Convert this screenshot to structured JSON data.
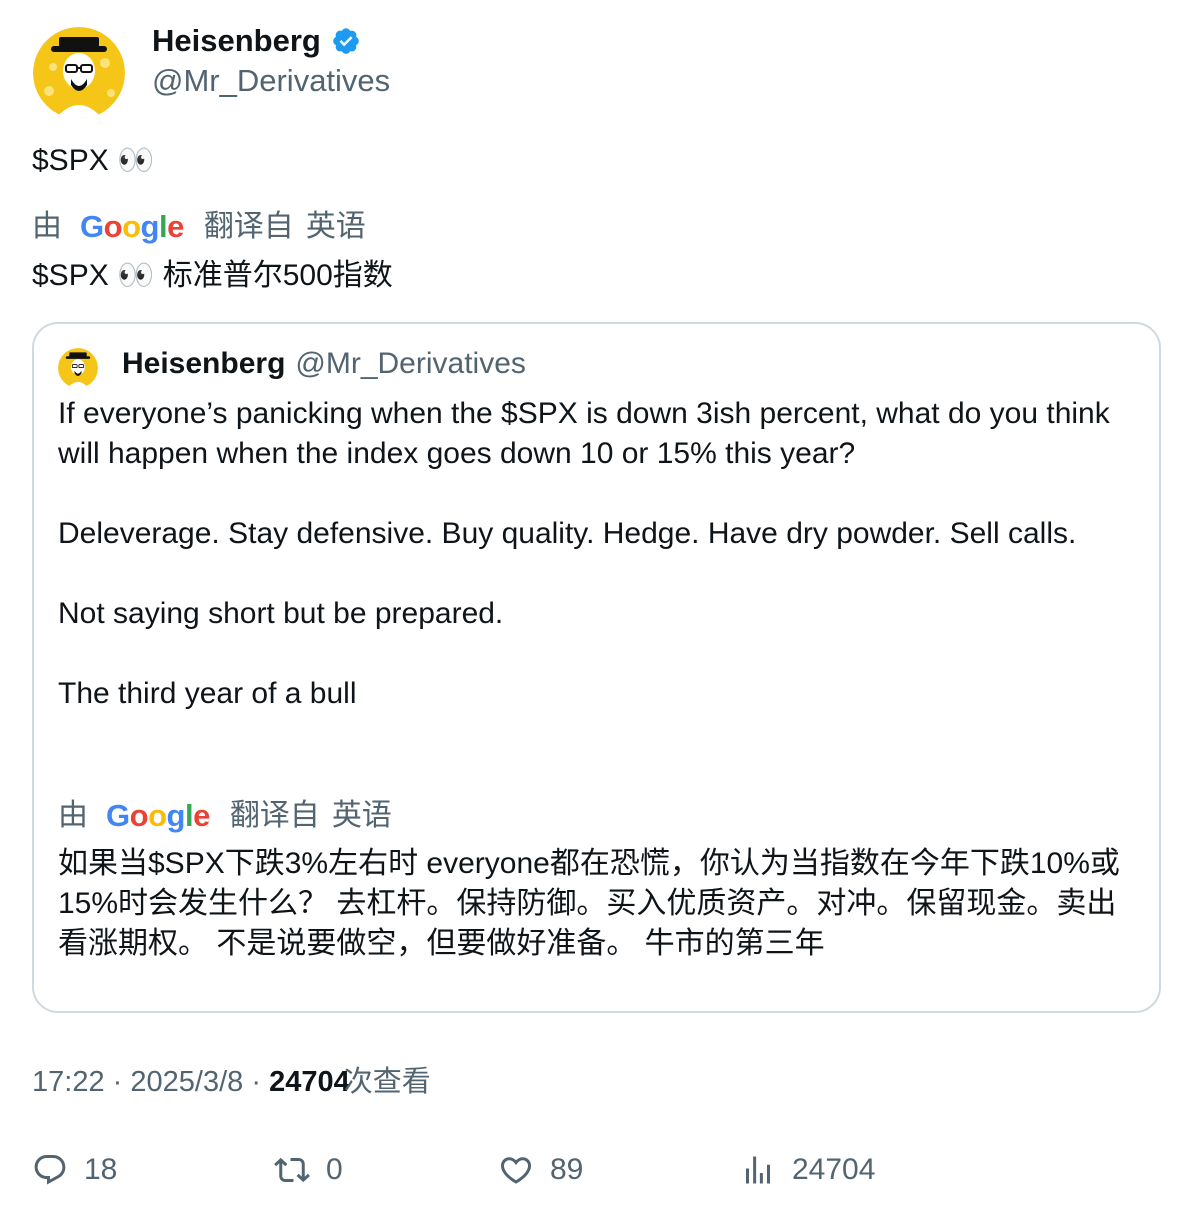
{
  "author": {
    "display_name": "Heisenberg",
    "handle": "@Mr_Derivatives",
    "verified": true,
    "avatar_icon": "heisenberg-avatar-icon"
  },
  "tweet": {
    "text": "$SPX 👀",
    "translation_label": {
      "by": "由",
      "service": "Google",
      "from": "翻译自",
      "language": "英语"
    },
    "translated_text": "$SPX 👀 标准普尔500指数"
  },
  "quote": {
    "display_name": "Heisenberg",
    "handle": "@Mr_Derivatives",
    "paragraphs": [
      "If everyone’s panicking when the $SPX is down 3ish percent, what do you think will happen when the index goes down 10 or 15% this year?",
      "Deleverage. Stay defensive. Buy quality. Hedge. Have dry powder. Sell calls.",
      "Not saying short but be prepared.",
      "The third year of a bull"
    ],
    "translation_label": {
      "by": "由",
      "service": "Google",
      "from": "翻译自",
      "language": "英语"
    },
    "translated_text": "如果当$SPX下跌3%左右时 everyone都在恐慌，你认为当指数在今年下跌10%或15%时会发生什么？ 去杠杆。保持防御。买入优质资产。对冲。保留现金。卖出看涨期权。 不是说要做空，但要做好准备。 牛市的第三年"
  },
  "meta": {
    "time": "17:22",
    "separator": "·",
    "date": "2025/3/8",
    "views_count": "24704",
    "views_label": "次查看"
  },
  "actions": {
    "replies": "18",
    "retweets": "0",
    "likes": "89",
    "views": "24704"
  },
  "colors": {
    "text_primary": "#0f1419",
    "text_secondary": "#536471",
    "verified_blue": "#1d9bf0",
    "border": "#cfd9de"
  }
}
